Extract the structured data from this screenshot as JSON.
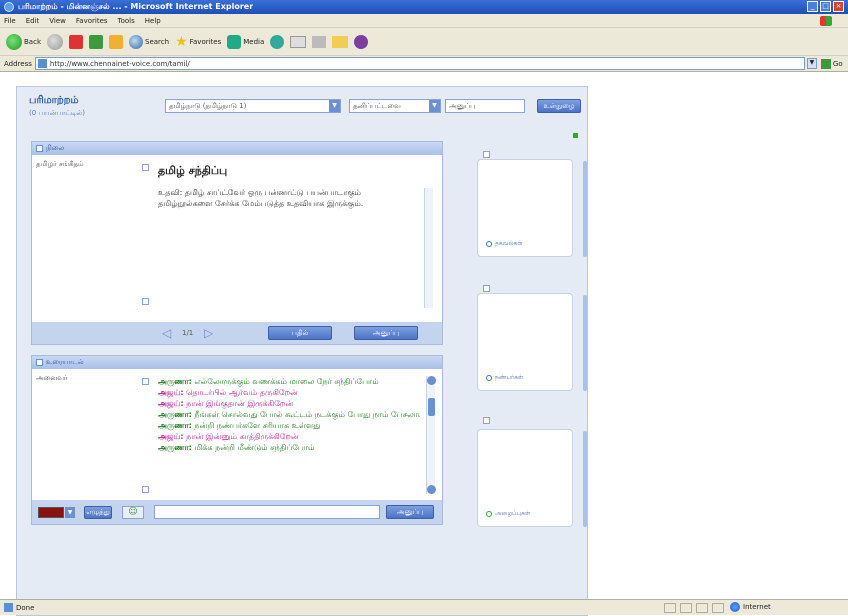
{
  "browser": {
    "title": "பரிமாற்றம் - மின்னஞ்சல் ... - Microsoft Internet Explorer",
    "menu": [
      "File",
      "Edit",
      "View",
      "Favorites",
      "Tools",
      "Help"
    ],
    "toolbar": {
      "back": "Back",
      "search": "Search",
      "favorites": "Favorites",
      "media": "Media"
    },
    "address_label": "Address",
    "address_value": "http://www.chennainet-voice.com/tamil/",
    "go_label": "Go",
    "status_text": "Done",
    "zone_text": "Internet"
  },
  "app": {
    "brand_name": "பரிமாற்றம்",
    "brand_sub": "(0 பயன்பாட்டில்)",
    "top_select_1": "தமிழ்நாடு (தமிழ்நாடு 1)",
    "top_select_2": "தனிப்பட்டவை",
    "top_input": "அனுப்பு",
    "top_button": "உள்நுழை",
    "compose_panel": {
      "header": "நிலை",
      "side_item": "தமிழர் சங்கீதம்",
      "title": "தமிழ் சந்திப்பு",
      "body": "உதவி: தமிழ் சாப்ட்வேர் ஒரு பன்னாட்டு பயன்பாடாகும் தமிழ்நூல்களை சேர்க்க மேம்படுத்த உதவியாக இருக்கும்.",
      "pager": "1/1",
      "btn_reply": "பதில்",
      "btn_send": "அனுப்பு"
    },
    "chat_panel": {
      "header": "உரையாடல்",
      "side_item": "அனைவர்",
      "messages": [
        {
          "who": "அருணா:",
          "text": "எல்லோருக்கும் வணக்கம் மாலை நேர் சந்திப்போம்",
          "style": "a"
        },
        {
          "who": "அஜய்:",
          "text": "தொடர்பில் ஆர்வம் தருகிறேன்",
          "style": "b"
        },
        {
          "who": "அஜய்:",
          "text": "நான் இங்குதான் இருக்கிறேன்",
          "style": "b"
        },
        {
          "who": "அருணா:",
          "text": "நீங்கள் சொல்வது போல் கூட்டம் நடக்கும் போது நாம் பேசலாம் உடனே",
          "style": "a"
        },
        {
          "who": "அருணா:",
          "text": "நன்றி நண்பர்களே சரியாக உள்ளது",
          "style": "a"
        },
        {
          "who": "அஜய்:",
          "text": "நான் இன்னும் காத்திருக்கிறேன்",
          "style": "b"
        },
        {
          "who": "அருணா:",
          "text": "மிக்க நன்றி மீண்டும் சந்திப்போம்",
          "style": "a"
        }
      ],
      "send_button": "அனுப்பு",
      "input_value": "",
      "color_label": "",
      "font_button": "எழுத்து"
    },
    "cards": [
      {
        "label": "தகவல்கள்"
      },
      {
        "label": "நண்பர்கள்"
      },
      {
        "label": "அழைப்புகள்"
      }
    ]
  },
  "colors": {
    "accent": "#4d74c4",
    "chat_a": "#1f7a1f",
    "chat_b": "#b0208f",
    "panel_bg": "#e4ebf5"
  }
}
